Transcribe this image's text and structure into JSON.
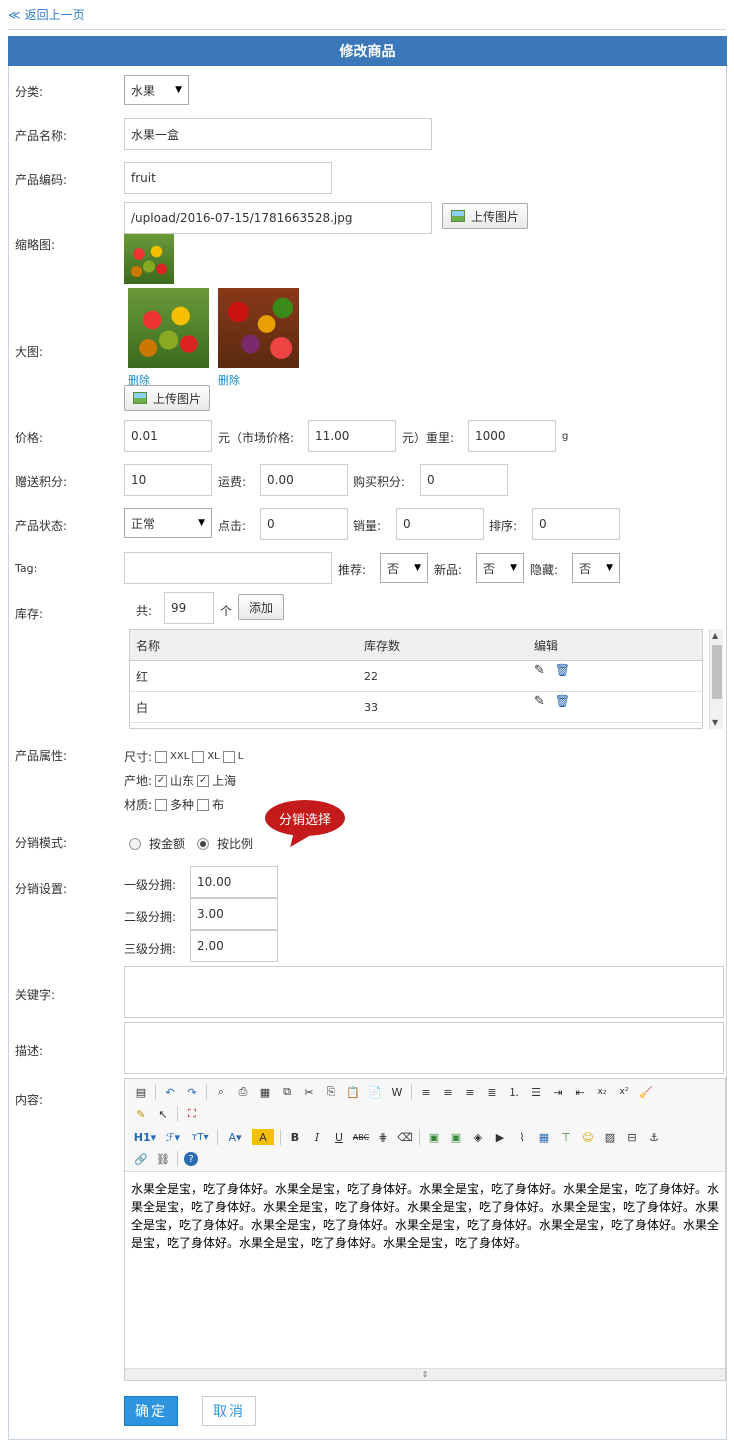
{
  "nav": {
    "back_label": "返回上一页"
  },
  "header": {
    "title": "修改商品"
  },
  "fields": {
    "category": {
      "label": "分类:",
      "value": "水果"
    },
    "name": {
      "label": "产品名称:",
      "value": "水果一盒"
    },
    "code": {
      "label": "产品编码:",
      "value": "fruit"
    },
    "thumb": {
      "label": "缩略图:",
      "path": "/upload/2016-07-15/1781663528.jpg",
      "upload_label": "上传图片"
    },
    "bigimg": {
      "label": "大图:",
      "delete_label": "删除",
      "upload_label": "上传图片"
    },
    "price": {
      "label": "价格:",
      "value": "0.01",
      "unit": "元（市场价格:",
      "market": "11.00",
      "weight_label": "元）重里:",
      "weight": "1000",
      "weight_unit": "g"
    },
    "points": {
      "label": "赠送积分:",
      "value": "10",
      "ship_label": "运费:",
      "ship": "0.00",
      "buy_label": "购买积分:",
      "buy": "0"
    },
    "status": {
      "label": "产品状态:",
      "value": "正常",
      "click_label": "点击:",
      "click": "0",
      "sales_label": "销量:",
      "sales": "0",
      "sort_label": "排序:",
      "sort": "0"
    },
    "tag": {
      "label": "Tag:",
      "value": "",
      "rec_label": "推荐:",
      "rec": "否",
      "new_label": "新品:",
      "new": "否",
      "hide_label": "隐藏:",
      "hide": "否"
    },
    "stock": {
      "label": "库存:",
      "total_label": "共:",
      "total": "99",
      "unit": "个",
      "add_label": "添加",
      "columns": [
        "名称",
        "库存数",
        "编辑"
      ],
      "rows": [
        {
          "name": "红",
          "qty": "22"
        },
        {
          "name": "白",
          "qty": "33"
        }
      ]
    },
    "attrs": {
      "label": "产品属性:",
      "size_label": "尺寸:",
      "sizes": [
        "XXL",
        "XL",
        "L"
      ],
      "origin_label": "产地:",
      "origins": [
        "山东",
        "上海"
      ],
      "material_label": "材质:",
      "materials": [
        "多种",
        "布"
      ]
    },
    "dist_mode": {
      "label": "分销模式:",
      "opt1": "按金额",
      "opt2": "按比例",
      "bubble": "分销选择"
    },
    "dist_set": {
      "label": "分销设置:",
      "l1_label": "一级分拥:",
      "l1": "10.00",
      "l2_label": "二级分拥:",
      "l2": "3.00",
      "l3_label": "三级分拥:",
      "l3": "2.00"
    },
    "keywords": {
      "label": "关键字:",
      "value": ""
    },
    "desc": {
      "label": "描述:",
      "value": ""
    },
    "content": {
      "label": "内容:",
      "text": "水果全是宝，吃了身体好。水果全是宝，吃了身体好。水果全是宝，吃了身体好。水果全是宝，吃了身体好。水果全是宝，吃了身体好。水果全是宝，吃了身体好。水果全是宝，吃了身体好。水果全是宝，吃了身体好。水果全是宝，吃了身体好。水果全是宝，吃了身体好。水果全是宝，吃了身体好。水果全是宝，吃了身体好。水果全是宝，吃了身体好。水果全是宝，吃了身体好。水果全是宝，吃了身体好。"
    }
  },
  "actions": {
    "ok": "确定",
    "cancel": "取消"
  }
}
